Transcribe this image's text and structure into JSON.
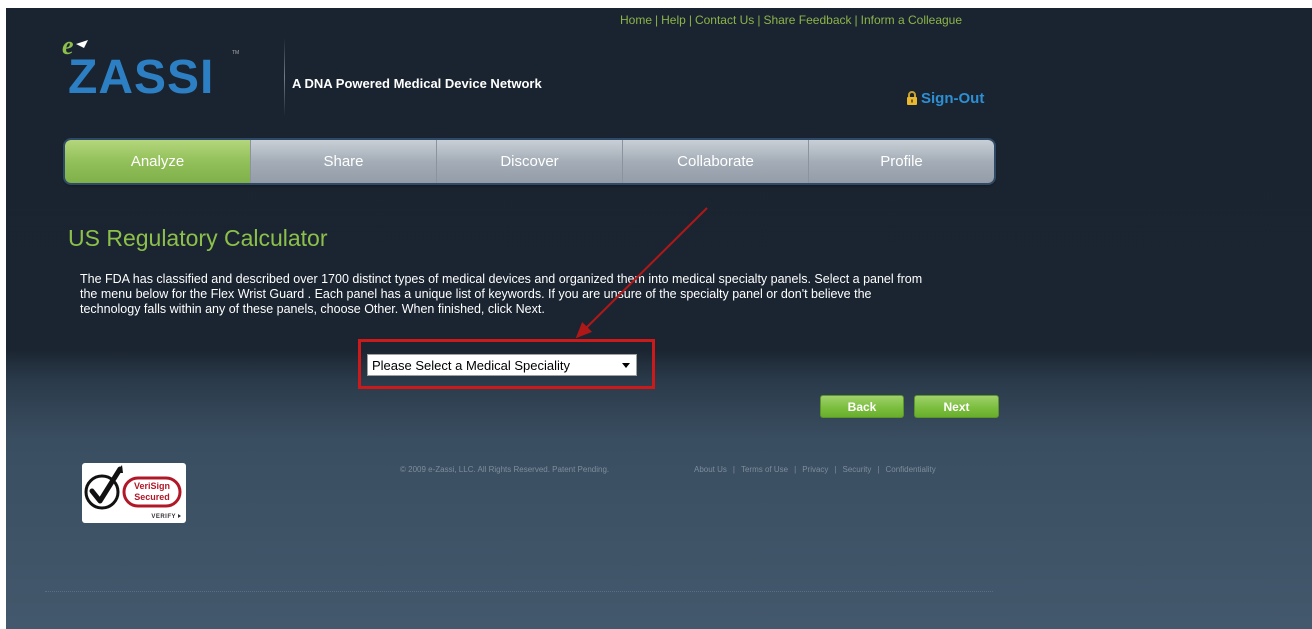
{
  "header": {
    "top_links": [
      "Home",
      "Help",
      "Contact Us",
      "Share Feedback",
      "Inform a Colleague"
    ],
    "logo_text": "ZASSI",
    "logo_prefix": "e",
    "logo_tm": "TM",
    "tagline": "A DNA Powered Medical Device Network",
    "signout_label": "Sign-Out",
    "signout_icon": "lock-icon"
  },
  "nav": {
    "tabs": [
      {
        "label": "Analyze",
        "active": true
      },
      {
        "label": "Share",
        "active": false
      },
      {
        "label": "Discover",
        "active": false
      },
      {
        "label": "Collaborate",
        "active": false
      },
      {
        "label": "Profile",
        "active": false
      }
    ]
  },
  "main": {
    "title": "US Regulatory Calculator",
    "description": "The FDA has classified and described over 1700 distinct types of medical devices and organized them into medical specialty panels. Select a panel from the menu below for the Flex Wrist Guard . Each panel has a unique list of keywords. If you are unsure of the specialty panel or don't believe the technology falls within any of these panels, choose Other. When finished, click Next.",
    "select_value": "Please Select a Medical Speciality",
    "back_label": "Back",
    "next_label": "Next"
  },
  "footer": {
    "verisign_line1": "VeriSign",
    "verisign_line2": "Secured",
    "verisign_verify": "VERIFY",
    "copyright": "© 2009 e-Zassi, LLC. All Rights Reserved. Patent Pending.",
    "links": [
      "About Us",
      "Terms of Use",
      "Privacy",
      "Security",
      "Confidentiality"
    ]
  },
  "colors": {
    "accent_green": "#8cc04a",
    "link_blue": "#2d8fd4",
    "highlight_red": "#cc1a1a"
  }
}
